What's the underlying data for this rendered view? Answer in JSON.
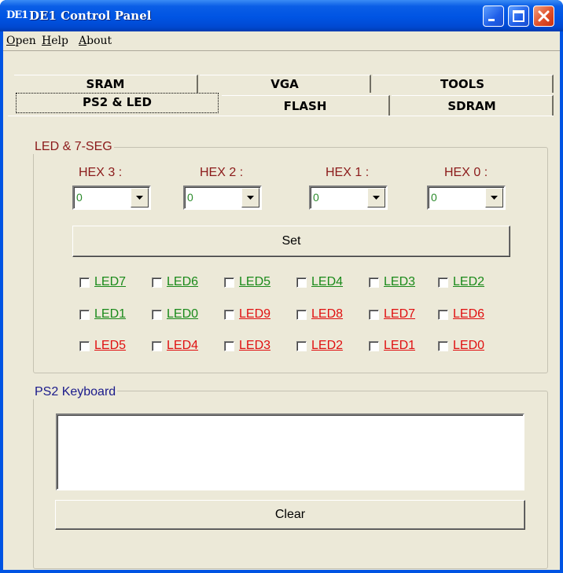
{
  "window": {
    "title": "DE1 Control Panel",
    "icon_text": "DE1",
    "accent_color": "#0054e3"
  },
  "menu": [
    {
      "label": "Open",
      "underline_char": "O",
      "rest": "pen"
    },
    {
      "label": "Help",
      "underline_char": "H",
      "rest": "elp"
    },
    {
      "label": "About",
      "underline_char": "A",
      "rest": "bout"
    }
  ],
  "tabs": {
    "back_row": [
      "SRAM",
      "VGA",
      "TOOLS"
    ],
    "front_row": [
      "PS2 & LED",
      "FLASH",
      "SDRAM"
    ],
    "active": "PS2 & LED"
  },
  "led_group": {
    "title": "LED & 7-SEG",
    "title_color": "#8b1a1a",
    "hex_labels": [
      "HEX 3 :",
      "HEX 2 :",
      "HEX 1 :",
      "HEX 0 :"
    ],
    "hex_values": [
      "0",
      "0",
      "0",
      "0"
    ],
    "set_label": "Set",
    "rows": [
      [
        {
          "label": "LED7",
          "color": "green",
          "checked": false
        },
        {
          "label": "LED6",
          "color": "green",
          "checked": false
        },
        {
          "label": "LED5",
          "color": "green",
          "checked": false
        },
        {
          "label": "LED4",
          "color": "green",
          "checked": false
        },
        {
          "label": "LED3",
          "color": "green",
          "checked": false
        },
        {
          "label": "LED2",
          "color": "green",
          "checked": false
        }
      ],
      [
        {
          "label": "LED1",
          "color": "green",
          "checked": false
        },
        {
          "label": "LED0",
          "color": "green",
          "checked": false
        },
        {
          "label": "LED9",
          "color": "red",
          "checked": false
        },
        {
          "label": "LED8",
          "color": "red",
          "checked": false
        },
        {
          "label": "LED7",
          "color": "red",
          "checked": false
        },
        {
          "label": "LED6",
          "color": "red",
          "checked": false
        }
      ],
      [
        {
          "label": "LED5",
          "color": "red",
          "checked": false
        },
        {
          "label": "LED4",
          "color": "red",
          "checked": false
        },
        {
          "label": "LED3",
          "color": "red",
          "checked": false
        },
        {
          "label": "LED2",
          "color": "red",
          "checked": false
        },
        {
          "label": "LED1",
          "color": "red",
          "checked": false
        },
        {
          "label": "LED0",
          "color": "red",
          "checked": false
        }
      ]
    ]
  },
  "ps2_group": {
    "title": "PS2 Keyboard",
    "title_color": "#1a1a8b",
    "text_value": "",
    "clear_label": "Clear"
  },
  "colors": {
    "led_green": "#1a8a1a",
    "led_red": "#e01010",
    "face": "#ece9d8"
  }
}
